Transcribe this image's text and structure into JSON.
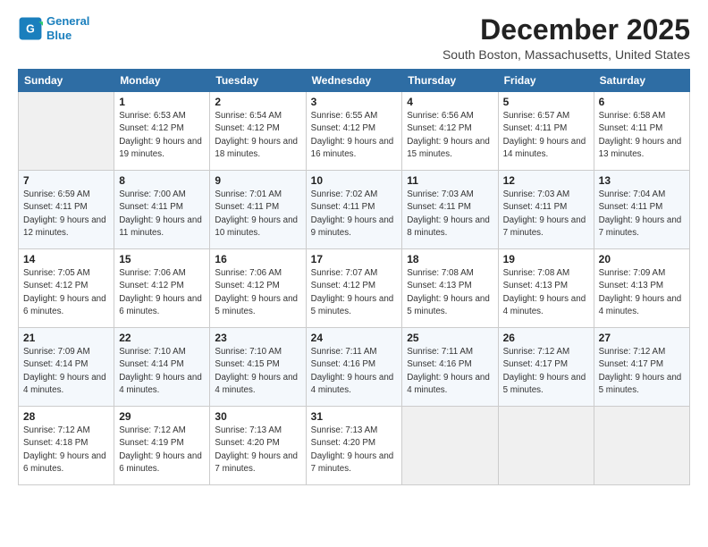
{
  "header": {
    "logo_line1": "General",
    "logo_line2": "Blue",
    "month": "December 2025",
    "location": "South Boston, Massachusetts, United States"
  },
  "weekdays": [
    "Sunday",
    "Monday",
    "Tuesday",
    "Wednesday",
    "Thursday",
    "Friday",
    "Saturday"
  ],
  "weeks": [
    [
      {
        "day": "",
        "empty": true
      },
      {
        "day": "1",
        "sunrise": "6:53 AM",
        "sunset": "4:12 PM",
        "daylight": "9 hours and 19 minutes."
      },
      {
        "day": "2",
        "sunrise": "6:54 AM",
        "sunset": "4:12 PM",
        "daylight": "9 hours and 18 minutes."
      },
      {
        "day": "3",
        "sunrise": "6:55 AM",
        "sunset": "4:12 PM",
        "daylight": "9 hours and 16 minutes."
      },
      {
        "day": "4",
        "sunrise": "6:56 AM",
        "sunset": "4:12 PM",
        "daylight": "9 hours and 15 minutes."
      },
      {
        "day": "5",
        "sunrise": "6:57 AM",
        "sunset": "4:11 PM",
        "daylight": "9 hours and 14 minutes."
      },
      {
        "day": "6",
        "sunrise": "6:58 AM",
        "sunset": "4:11 PM",
        "daylight": "9 hours and 13 minutes."
      }
    ],
    [
      {
        "day": "7",
        "sunrise": "6:59 AM",
        "sunset": "4:11 PM",
        "daylight": "9 hours and 12 minutes."
      },
      {
        "day": "8",
        "sunrise": "7:00 AM",
        "sunset": "4:11 PM",
        "daylight": "9 hours and 11 minutes."
      },
      {
        "day": "9",
        "sunrise": "7:01 AM",
        "sunset": "4:11 PM",
        "daylight": "9 hours and 10 minutes."
      },
      {
        "day": "10",
        "sunrise": "7:02 AM",
        "sunset": "4:11 PM",
        "daylight": "9 hours and 9 minutes."
      },
      {
        "day": "11",
        "sunrise": "7:03 AM",
        "sunset": "4:11 PM",
        "daylight": "9 hours and 8 minutes."
      },
      {
        "day": "12",
        "sunrise": "7:03 AM",
        "sunset": "4:11 PM",
        "daylight": "9 hours and 7 minutes."
      },
      {
        "day": "13",
        "sunrise": "7:04 AM",
        "sunset": "4:11 PM",
        "daylight": "9 hours and 7 minutes."
      }
    ],
    [
      {
        "day": "14",
        "sunrise": "7:05 AM",
        "sunset": "4:12 PM",
        "daylight": "9 hours and 6 minutes."
      },
      {
        "day": "15",
        "sunrise": "7:06 AM",
        "sunset": "4:12 PM",
        "daylight": "9 hours and 6 minutes."
      },
      {
        "day": "16",
        "sunrise": "7:06 AM",
        "sunset": "4:12 PM",
        "daylight": "9 hours and 5 minutes."
      },
      {
        "day": "17",
        "sunrise": "7:07 AM",
        "sunset": "4:12 PM",
        "daylight": "9 hours and 5 minutes."
      },
      {
        "day": "18",
        "sunrise": "7:08 AM",
        "sunset": "4:13 PM",
        "daylight": "9 hours and 5 minutes."
      },
      {
        "day": "19",
        "sunrise": "7:08 AM",
        "sunset": "4:13 PM",
        "daylight": "9 hours and 4 minutes."
      },
      {
        "day": "20",
        "sunrise": "7:09 AM",
        "sunset": "4:13 PM",
        "daylight": "9 hours and 4 minutes."
      }
    ],
    [
      {
        "day": "21",
        "sunrise": "7:09 AM",
        "sunset": "4:14 PM",
        "daylight": "9 hours and 4 minutes."
      },
      {
        "day": "22",
        "sunrise": "7:10 AM",
        "sunset": "4:14 PM",
        "daylight": "9 hours and 4 minutes."
      },
      {
        "day": "23",
        "sunrise": "7:10 AM",
        "sunset": "4:15 PM",
        "daylight": "9 hours and 4 minutes."
      },
      {
        "day": "24",
        "sunrise": "7:11 AM",
        "sunset": "4:16 PM",
        "daylight": "9 hours and 4 minutes."
      },
      {
        "day": "25",
        "sunrise": "7:11 AM",
        "sunset": "4:16 PM",
        "daylight": "9 hours and 4 minutes."
      },
      {
        "day": "26",
        "sunrise": "7:12 AM",
        "sunset": "4:17 PM",
        "daylight": "9 hours and 5 minutes."
      },
      {
        "day": "27",
        "sunrise": "7:12 AM",
        "sunset": "4:17 PM",
        "daylight": "9 hours and 5 minutes."
      }
    ],
    [
      {
        "day": "28",
        "sunrise": "7:12 AM",
        "sunset": "4:18 PM",
        "daylight": "9 hours and 6 minutes."
      },
      {
        "day": "29",
        "sunrise": "7:12 AM",
        "sunset": "4:19 PM",
        "daylight": "9 hours and 6 minutes."
      },
      {
        "day": "30",
        "sunrise": "7:13 AM",
        "sunset": "4:20 PM",
        "daylight": "9 hours and 7 minutes."
      },
      {
        "day": "31",
        "sunrise": "7:13 AM",
        "sunset": "4:20 PM",
        "daylight": "9 hours and 7 minutes."
      },
      {
        "day": "",
        "empty": true
      },
      {
        "day": "",
        "empty": true
      },
      {
        "day": "",
        "empty": true
      }
    ]
  ]
}
